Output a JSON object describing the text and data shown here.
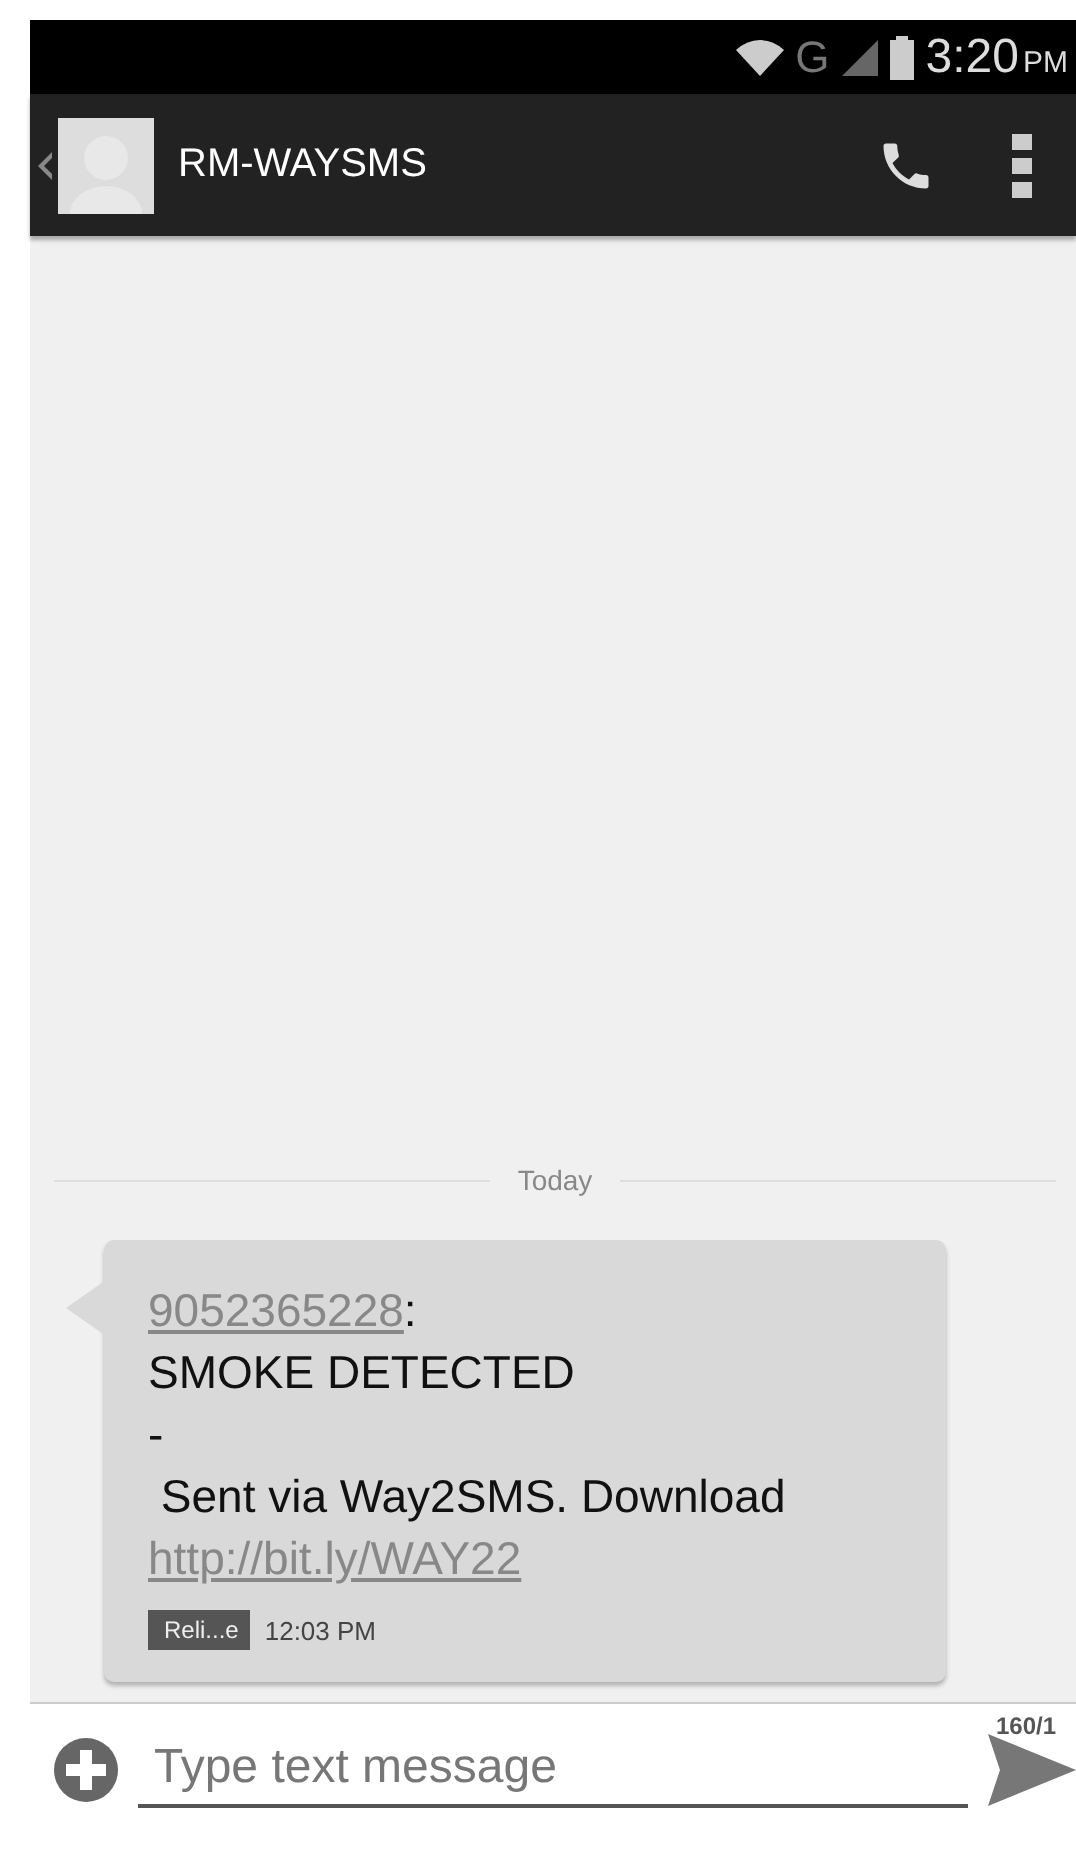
{
  "status_bar": {
    "network": "G",
    "time": "3:20",
    "ampm": "PM"
  },
  "app_bar": {
    "title": "RM-WAYSMS"
  },
  "date_divider": "Today",
  "message": {
    "sender": "9052365228",
    "separator": ":",
    "lines": [
      "SMOKE DETECTED",
      "-",
      " Sent via Way2SMS. Download"
    ],
    "link": "http://bit.ly/WAY22",
    "sim_label": "Reli...e",
    "time": "12:03 PM"
  },
  "composer": {
    "counter": "160/1",
    "placeholder": "Type text message"
  }
}
